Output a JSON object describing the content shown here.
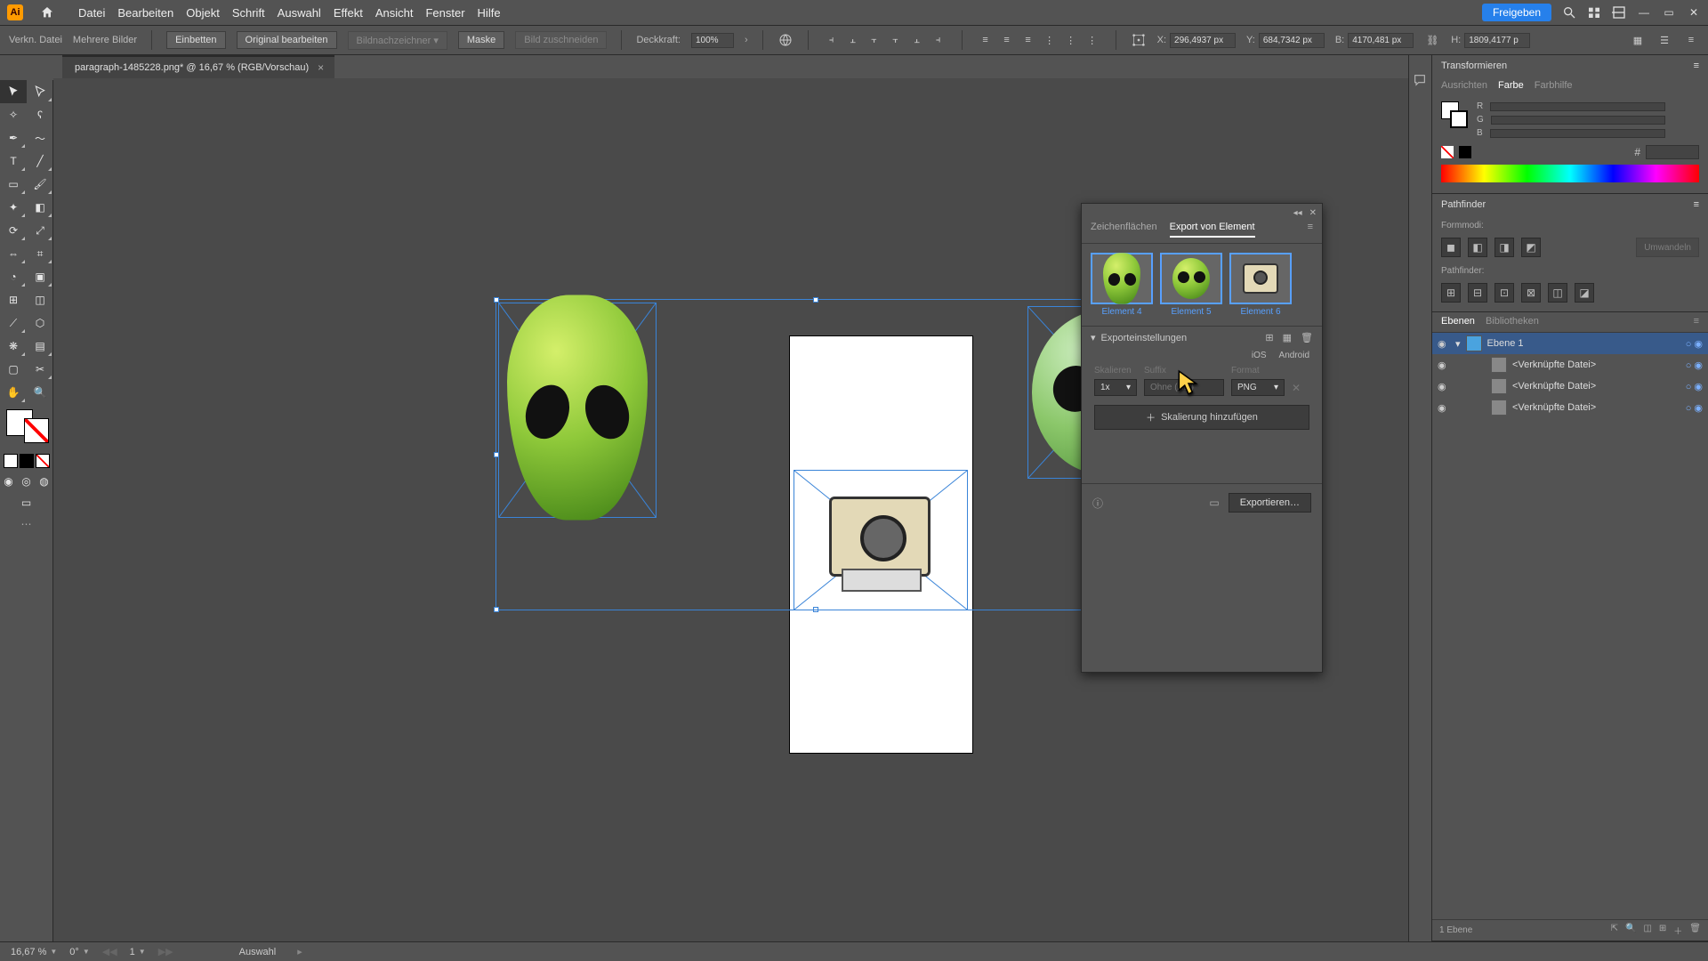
{
  "menu": {
    "items": [
      "Datei",
      "Bearbeiten",
      "Objekt",
      "Schrift",
      "Auswahl",
      "Effekt",
      "Ansicht",
      "Fenster",
      "Hilfe"
    ]
  },
  "share_label": "Freigeben",
  "optbar": {
    "left1": "Verkn. Datei",
    "left2": "Mehrere Bilder",
    "embed": "Einbetten",
    "edit_orig": "Original bearbeiten",
    "image_trace": "Bildnachzeichner",
    "mask": "Maske",
    "crop": "Bild zuschneiden",
    "opacity_label": "Deckkraft:",
    "opacity_value": "100%",
    "x_label": "X:",
    "x_value": "296,4937 px",
    "y_label": "Y:",
    "y_value": "684,7342 px",
    "w_label": "B:",
    "w_value": "4170,481 px",
    "h_label": "H:",
    "h_value": "1809,4177 p"
  },
  "doc_tab": {
    "title": "paragraph-1485228.png* @ 16,67 % (RGB/Vorschau)",
    "close": "×"
  },
  "export_panel": {
    "tab1": "Zeichenflächen",
    "tab2": "Export von Element",
    "thumbs": [
      {
        "caption": "Element 4"
      },
      {
        "caption": "Element 5"
      },
      {
        "caption": "Element 6"
      }
    ],
    "settings_label": "Exporteinstellungen",
    "platform_ios": "iOS",
    "platform_android": "Android",
    "col_scale": "Skalieren",
    "col_suffix": "Suffix",
    "col_format": "Format",
    "scale_value": "1x",
    "suffix_placeholder": "Ohne (Aut)",
    "format_value": "PNG",
    "add_scale": "Skalierung hinzufügen",
    "export_btn": "Exportieren…"
  },
  "right": {
    "transform_hdr": "Transformieren",
    "subtabs": {
      "align": "Ausrichten",
      "color": "Farbe",
      "guide": "Farbhilfe"
    },
    "rgb": {
      "r": "R",
      "g": "G",
      "b": "B",
      "hex_label": "#"
    },
    "pathfinder_hdr": "Pathfinder",
    "pf_mode": "Formmodi:",
    "pf_label": "Pathfinder:",
    "pf_expand": "Umwandeln",
    "layers_tab": "Ebenen",
    "libs_tab": "Bibliotheken",
    "layer_root": "Ebene 1",
    "linked": "<Verknüpfte Datei>",
    "layer_count": "1 Ebene"
  },
  "status": {
    "zoom": "16,67 %",
    "rotate": "0°",
    "artboard_num": "1",
    "tool": "Auswahl"
  }
}
